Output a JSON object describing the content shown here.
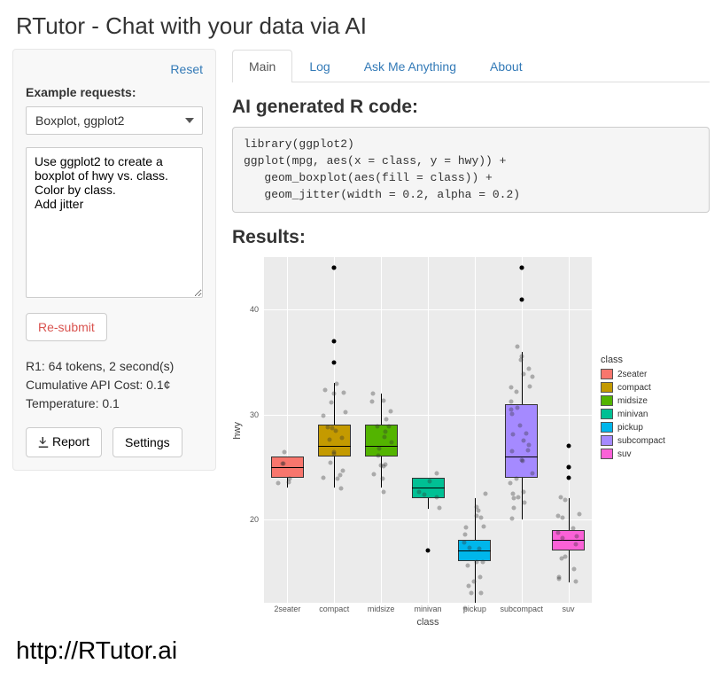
{
  "title": "RTutor - Chat with your data via AI",
  "sidebar": {
    "reset": "Reset",
    "examples_label": "Example requests:",
    "selected_example": "Boxplot, ggplot2",
    "prompt_text": "Use ggplot2 to create a boxplot of hwy vs. class. Color by class.\nAdd jitter",
    "submit_label": "Re-submit",
    "stat_tokens": "R1: 64 tokens, 2 second(s)",
    "stat_cost": "Cumulative API Cost: 0.1¢",
    "stat_temp": "Temperature: 0.1",
    "report_label": "Report",
    "settings_label": "Settings"
  },
  "tabs": [
    {
      "label": "Main",
      "active": true
    },
    {
      "label": "Log",
      "active": false
    },
    {
      "label": "Ask Me Anything",
      "active": false
    },
    {
      "label": "About",
      "active": false
    }
  ],
  "code_heading": "AI generated R code:",
  "code": "library(ggplot2)\nggplot(mpg, aes(x = class, y = hwy)) +\n   geom_boxplot(aes(fill = class)) +\n   geom_jitter(width = 0.2, alpha = 0.2)",
  "results_heading": "Results:",
  "chart_data": {
    "type": "boxplot",
    "xlabel": "class",
    "ylabel": "hwy",
    "ylim": [
      12,
      45
    ],
    "y_ticks": [
      20,
      30,
      40
    ],
    "categories": [
      "2seater",
      "compact",
      "midsize",
      "minivan",
      "pickup",
      "subcompact",
      "suv"
    ],
    "legend_title": "class",
    "legend": [
      {
        "name": "2seater",
        "color": "#F8766D"
      },
      {
        "name": "compact",
        "color": "#C49A00"
      },
      {
        "name": "midsize",
        "color": "#53B400"
      },
      {
        "name": "minivan",
        "color": "#00C094"
      },
      {
        "name": "pickup",
        "color": "#00B6EB"
      },
      {
        "name": "subcompact",
        "color": "#A58AFF"
      },
      {
        "name": "suv",
        "color": "#FB61D7"
      }
    ],
    "boxes": [
      {
        "cat": "2seater",
        "q1": 24,
        "median": 25,
        "q3": 26,
        "low": 23,
        "high": 26,
        "outliers": []
      },
      {
        "cat": "compact",
        "q1": 26,
        "median": 27,
        "q3": 29,
        "low": 23,
        "high": 33,
        "outliers": [
          35,
          37,
          44,
          44
        ]
      },
      {
        "cat": "midsize",
        "q1": 26,
        "median": 27,
        "q3": 29,
        "low": 23,
        "high": 32,
        "outliers": []
      },
      {
        "cat": "minivan",
        "q1": 22,
        "median": 23,
        "q3": 24,
        "low": 21,
        "high": 24,
        "outliers": [
          17
        ]
      },
      {
        "cat": "pickup",
        "q1": 16,
        "median": 17,
        "q3": 18,
        "low": 12,
        "high": 22,
        "outliers": []
      },
      {
        "cat": "subcompact",
        "q1": 24,
        "median": 26,
        "q3": 31,
        "low": 20,
        "high": 36,
        "outliers": [
          41,
          44,
          44
        ]
      },
      {
        "cat": "suv",
        "q1": 17,
        "median": 18,
        "q3": 19,
        "low": 14,
        "high": 22,
        "outliers": [
          24,
          25,
          25,
          27
        ]
      }
    ],
    "jitter_range": 0.18
  },
  "footer_url": "http://RTutor.ai"
}
